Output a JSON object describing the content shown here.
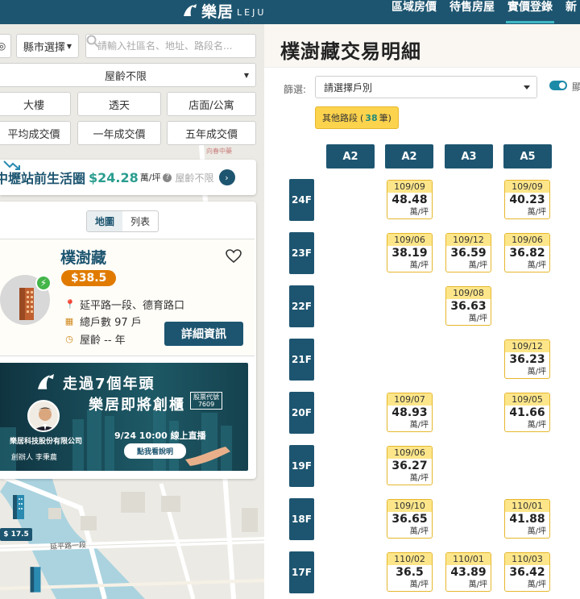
{
  "brand": {
    "cn": "樂居",
    "en": "LEJU"
  },
  "nav": [
    "區域房價",
    "待售房屋",
    "實價登錄",
    "新"
  ],
  "nav_active_index": 2,
  "map_controls": {
    "city_select": "縣市選擇",
    "search_placeholder": "請輸入社區名、地址、路段名...",
    "age_select": "屋齡不限",
    "types": [
      "大樓",
      "透天",
      "店面/公寓"
    ],
    "price_modes": [
      "平均成交價",
      "一年成交價",
      "五年成交價"
    ]
  },
  "area_summary": {
    "name": "中壢站前生活圈",
    "price": "$24.28",
    "unit": "萬/坪",
    "age": "屋齡不限"
  },
  "view_tabs": [
    "地圖",
    "列表"
  ],
  "property": {
    "name": "樸澍藏",
    "price_badge": "$38.5",
    "address": "延平路一段、德育路口",
    "households": "總戶數 97 戶",
    "age": "屋齡 -- 年",
    "detail_button": "詳細資訊"
  },
  "ad": {
    "line1": "走過7個年頭",
    "line2": "樂居即將創櫃",
    "stock_code_label": "股票代號",
    "stock_code": "7609",
    "company": "樂居科技股份有限公司",
    "founder": "創辦人 李秉農",
    "date": "9/24 10:00 線上直播",
    "cta": "點我看說明"
  },
  "map_labels": {
    "price_tag": "$ 17.5",
    "road_name": "延平路一段",
    "poi": "向春中藥"
  },
  "detail": {
    "title": "樸澍藏交易明細",
    "filter_label": "篩選:",
    "filter_select": "請選擇戶別",
    "toggle_label": "顯",
    "road_chip": {
      "label": "其他路段",
      "count": "38",
      "suffix": "筆"
    },
    "columns": [
      "A2",
      "A2",
      "A3",
      "A5"
    ],
    "unit": "萬/坪",
    "floors": [
      {
        "floor": "24F",
        "cells": [
          null,
          {
            "date": "109/09",
            "price": "48.48"
          },
          null,
          {
            "date": "109/09",
            "price": "40.23"
          }
        ]
      },
      {
        "floor": "23F",
        "cells": [
          null,
          {
            "date": "109/06",
            "price": "38.19"
          },
          {
            "date": "109/12",
            "price": "36.59"
          },
          {
            "date": "109/06",
            "price": "36.82"
          }
        ]
      },
      {
        "floor": "22F",
        "cells": [
          null,
          null,
          {
            "date": "109/08",
            "price": "36.63"
          },
          null
        ]
      },
      {
        "floor": "21F",
        "cells": [
          null,
          null,
          null,
          {
            "date": "109/12",
            "price": "36.23"
          }
        ]
      },
      {
        "floor": "20F",
        "cells": [
          null,
          {
            "date": "109/07",
            "price": "48.93"
          },
          null,
          {
            "date": "109/05",
            "price": "41.66"
          }
        ]
      },
      {
        "floor": "19F",
        "cells": [
          null,
          {
            "date": "109/06",
            "price": "36.27"
          },
          null,
          null
        ]
      },
      {
        "floor": "18F",
        "cells": [
          null,
          {
            "date": "109/10",
            "price": "36.65"
          },
          null,
          {
            "date": "110/01",
            "price": "41.88"
          }
        ]
      },
      {
        "floor": "17F",
        "cells": [
          null,
          {
            "date": "110/02",
            "price": "36.5"
          },
          {
            "date": "110/01",
            "price": "43.89"
          },
          {
            "date": "110/03",
            "price": "36.42"
          }
        ]
      }
    ]
  },
  "colors": {
    "primary": "#1d5570",
    "accent_teal": "#3fb7c4",
    "price_green": "#2a9d8f",
    "badge_orange": "#e07b00",
    "cell_yellow": "#fde68a"
  }
}
